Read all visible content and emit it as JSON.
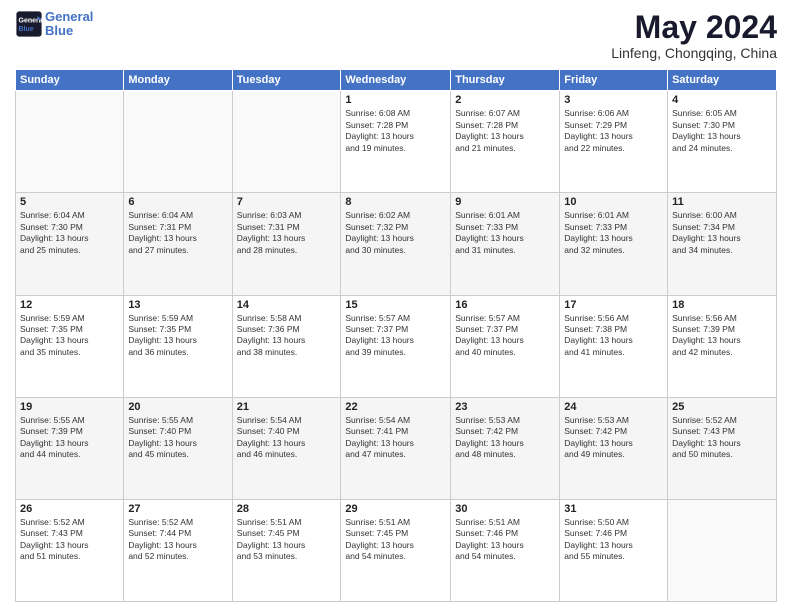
{
  "header": {
    "logo_line1": "General",
    "logo_line2": "Blue",
    "main_title": "May 2024",
    "subtitle": "Linfeng, Chongqing, China"
  },
  "weekdays": [
    "Sunday",
    "Monday",
    "Tuesday",
    "Wednesday",
    "Thursday",
    "Friday",
    "Saturday"
  ],
  "weeks": [
    [
      {
        "day": "",
        "info": ""
      },
      {
        "day": "",
        "info": ""
      },
      {
        "day": "",
        "info": ""
      },
      {
        "day": "1",
        "info": "Sunrise: 6:08 AM\nSunset: 7:28 PM\nDaylight: 13 hours\nand 19 minutes."
      },
      {
        "day": "2",
        "info": "Sunrise: 6:07 AM\nSunset: 7:28 PM\nDaylight: 13 hours\nand 21 minutes."
      },
      {
        "day": "3",
        "info": "Sunrise: 6:06 AM\nSunset: 7:29 PM\nDaylight: 13 hours\nand 22 minutes."
      },
      {
        "day": "4",
        "info": "Sunrise: 6:05 AM\nSunset: 7:30 PM\nDaylight: 13 hours\nand 24 minutes."
      }
    ],
    [
      {
        "day": "5",
        "info": "Sunrise: 6:04 AM\nSunset: 7:30 PM\nDaylight: 13 hours\nand 25 minutes."
      },
      {
        "day": "6",
        "info": "Sunrise: 6:04 AM\nSunset: 7:31 PM\nDaylight: 13 hours\nand 27 minutes."
      },
      {
        "day": "7",
        "info": "Sunrise: 6:03 AM\nSunset: 7:31 PM\nDaylight: 13 hours\nand 28 minutes."
      },
      {
        "day": "8",
        "info": "Sunrise: 6:02 AM\nSunset: 7:32 PM\nDaylight: 13 hours\nand 30 minutes."
      },
      {
        "day": "9",
        "info": "Sunrise: 6:01 AM\nSunset: 7:33 PM\nDaylight: 13 hours\nand 31 minutes."
      },
      {
        "day": "10",
        "info": "Sunrise: 6:01 AM\nSunset: 7:33 PM\nDaylight: 13 hours\nand 32 minutes."
      },
      {
        "day": "11",
        "info": "Sunrise: 6:00 AM\nSunset: 7:34 PM\nDaylight: 13 hours\nand 34 minutes."
      }
    ],
    [
      {
        "day": "12",
        "info": "Sunrise: 5:59 AM\nSunset: 7:35 PM\nDaylight: 13 hours\nand 35 minutes."
      },
      {
        "day": "13",
        "info": "Sunrise: 5:59 AM\nSunset: 7:35 PM\nDaylight: 13 hours\nand 36 minutes."
      },
      {
        "day": "14",
        "info": "Sunrise: 5:58 AM\nSunset: 7:36 PM\nDaylight: 13 hours\nand 38 minutes."
      },
      {
        "day": "15",
        "info": "Sunrise: 5:57 AM\nSunset: 7:37 PM\nDaylight: 13 hours\nand 39 minutes."
      },
      {
        "day": "16",
        "info": "Sunrise: 5:57 AM\nSunset: 7:37 PM\nDaylight: 13 hours\nand 40 minutes."
      },
      {
        "day": "17",
        "info": "Sunrise: 5:56 AM\nSunset: 7:38 PM\nDaylight: 13 hours\nand 41 minutes."
      },
      {
        "day": "18",
        "info": "Sunrise: 5:56 AM\nSunset: 7:39 PM\nDaylight: 13 hours\nand 42 minutes."
      }
    ],
    [
      {
        "day": "19",
        "info": "Sunrise: 5:55 AM\nSunset: 7:39 PM\nDaylight: 13 hours\nand 44 minutes."
      },
      {
        "day": "20",
        "info": "Sunrise: 5:55 AM\nSunset: 7:40 PM\nDaylight: 13 hours\nand 45 minutes."
      },
      {
        "day": "21",
        "info": "Sunrise: 5:54 AM\nSunset: 7:40 PM\nDaylight: 13 hours\nand 46 minutes."
      },
      {
        "day": "22",
        "info": "Sunrise: 5:54 AM\nSunset: 7:41 PM\nDaylight: 13 hours\nand 47 minutes."
      },
      {
        "day": "23",
        "info": "Sunrise: 5:53 AM\nSunset: 7:42 PM\nDaylight: 13 hours\nand 48 minutes."
      },
      {
        "day": "24",
        "info": "Sunrise: 5:53 AM\nSunset: 7:42 PM\nDaylight: 13 hours\nand 49 minutes."
      },
      {
        "day": "25",
        "info": "Sunrise: 5:52 AM\nSunset: 7:43 PM\nDaylight: 13 hours\nand 50 minutes."
      }
    ],
    [
      {
        "day": "26",
        "info": "Sunrise: 5:52 AM\nSunset: 7:43 PM\nDaylight: 13 hours\nand 51 minutes."
      },
      {
        "day": "27",
        "info": "Sunrise: 5:52 AM\nSunset: 7:44 PM\nDaylight: 13 hours\nand 52 minutes."
      },
      {
        "day": "28",
        "info": "Sunrise: 5:51 AM\nSunset: 7:45 PM\nDaylight: 13 hours\nand 53 minutes."
      },
      {
        "day": "29",
        "info": "Sunrise: 5:51 AM\nSunset: 7:45 PM\nDaylight: 13 hours\nand 54 minutes."
      },
      {
        "day": "30",
        "info": "Sunrise: 5:51 AM\nSunset: 7:46 PM\nDaylight: 13 hours\nand 54 minutes."
      },
      {
        "day": "31",
        "info": "Sunrise: 5:50 AM\nSunset: 7:46 PM\nDaylight: 13 hours\nand 55 minutes."
      },
      {
        "day": "",
        "info": ""
      }
    ]
  ]
}
